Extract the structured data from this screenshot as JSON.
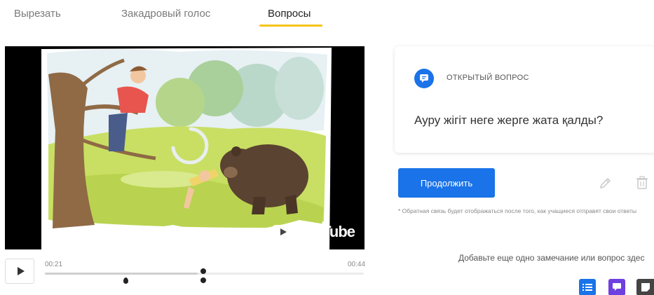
{
  "tabs": [
    {
      "label": "Вырезать",
      "active": false
    },
    {
      "label": "Закадровый голос",
      "active": false
    },
    {
      "label": "Вопросы",
      "active": true
    }
  ],
  "colors": {
    "accent": "#1a73e8",
    "tab_underline": "#f5c518",
    "add_note_btn": "#444444"
  },
  "video": {
    "watermark": "YouTube",
    "current_time": "00:21",
    "duration": "00:44",
    "progress": 0.48
  },
  "question_card": {
    "icon": "comment-icon",
    "type_label": "ОТКРЫТЫЙ ВОПРОС",
    "question_text": "Ауру жігіт неге жерге жата қалды?"
  },
  "actions": {
    "continue_label": "Продолжить",
    "edit_icon": "pencil-icon",
    "delete_icon": "trash-icon"
  },
  "feedback_note": "* Обратная связь будет отображаться после того, как учащиеся отправят свои ответы",
  "add_prompt": "Добавьте еще одно замечание или вопрос здес",
  "add_buttons": [
    {
      "icon": "list-icon",
      "color": "#1a73e8"
    },
    {
      "icon": "comment-icon",
      "color": "#6f3fe0"
    },
    {
      "icon": "note-icon",
      "color": "#444444"
    }
  ]
}
